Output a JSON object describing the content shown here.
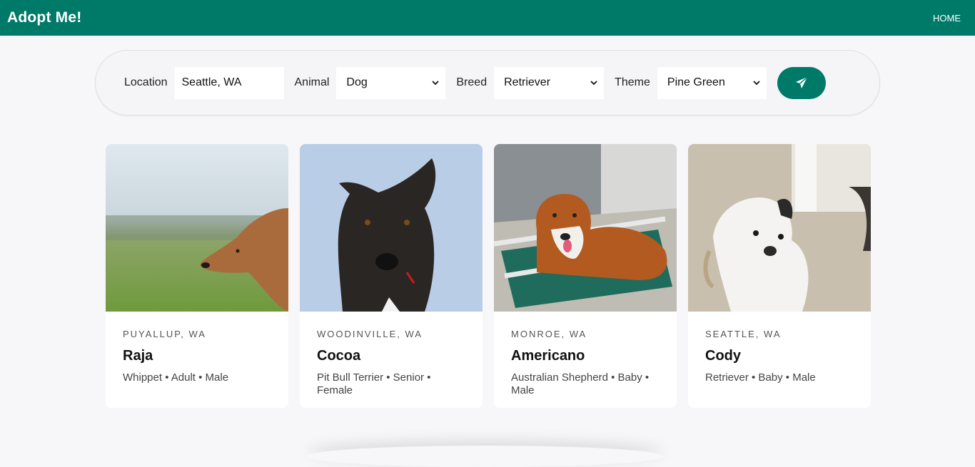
{
  "header": {
    "brand": "Adopt Me!",
    "nav_home": "HOME"
  },
  "search": {
    "location_label": "Location",
    "location_value": "Seattle, WA",
    "animal_label": "Animal",
    "animal_value": "Dog",
    "breed_label": "Breed",
    "breed_value": "Retriever",
    "theme_label": "Theme",
    "theme_value": "Pine Green",
    "submit_icon": "paper-plane-icon"
  },
  "colors": {
    "accent": "#007a68",
    "background": "#f7f7f9"
  },
  "pets": [
    {
      "location": "PUYALLUP, WA",
      "name": "Raja",
      "meta": "Whippet • Adult • Male"
    },
    {
      "location": "WOODINVILLE, WA",
      "name": "Cocoa",
      "meta": "Pit Bull Terrier • Senior • Female"
    },
    {
      "location": "MONROE, WA",
      "name": "Americano",
      "meta": "Australian Shepherd • Baby • Male"
    },
    {
      "location": "SEATTLE, WA",
      "name": "Cody",
      "meta": "Retriever • Baby • Male"
    }
  ]
}
